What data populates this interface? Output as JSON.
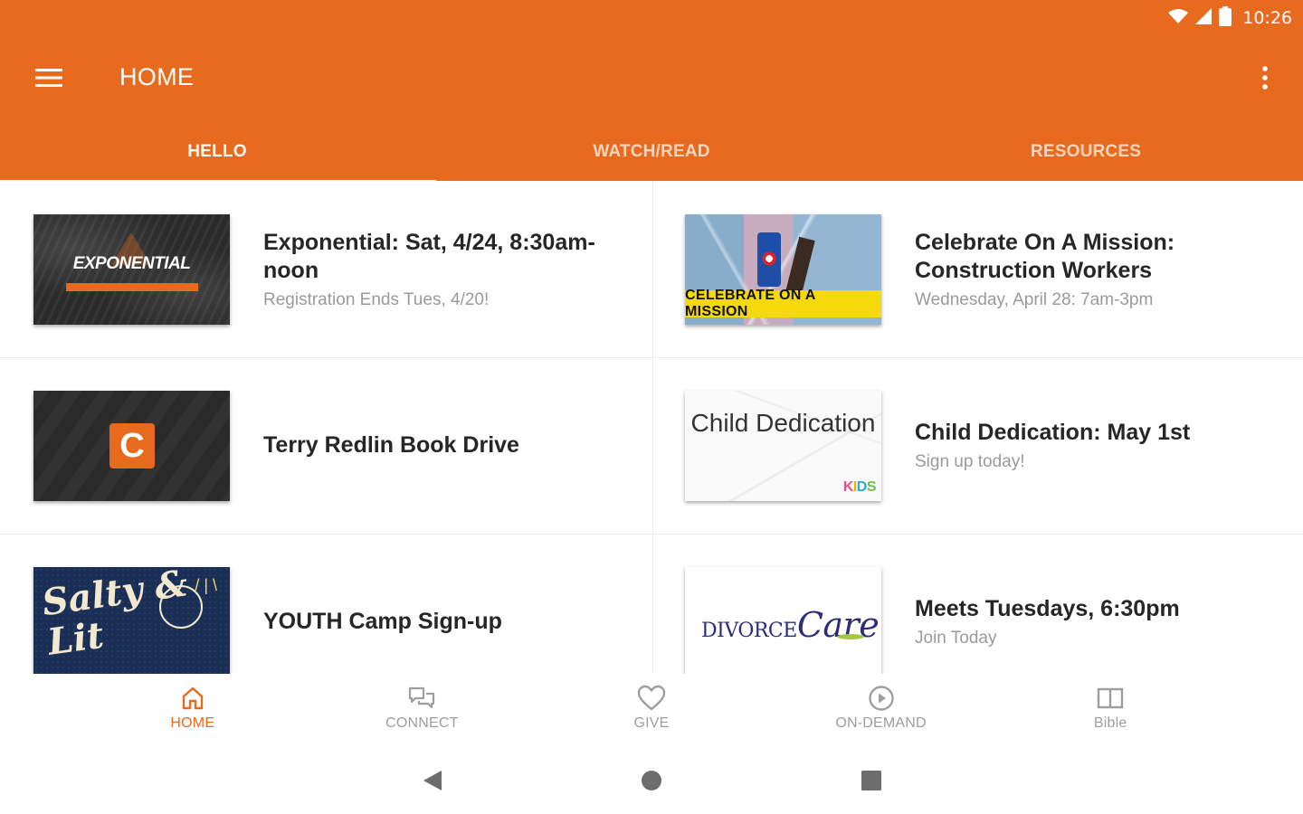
{
  "status_bar": {
    "time": "10:26"
  },
  "app_bar": {
    "title": "HOME"
  },
  "tabs": [
    {
      "label": "HELLO",
      "active": true
    },
    {
      "label": "WATCH/READ",
      "active": false
    },
    {
      "label": "RESOURCES",
      "active": false
    }
  ],
  "feed": [
    {
      "title": "Exponential: Sat, 4/24, 8:30am-noon",
      "subtitle": "Registration Ends Tues, 4/20!",
      "image_text": "EXPONENTIAL"
    },
    {
      "title": "Celebrate On A Mission: Construction Workers",
      "subtitle": "Wednesday, April 28: 7am-3pm",
      "image_text": "CELEBRATE ON A MISSION"
    },
    {
      "title": "Terry Redlin Book Drive",
      "subtitle": "",
      "image_text": "C"
    },
    {
      "title": "Child Dedication: May 1st",
      "subtitle": "Sign up today!",
      "image_text": "Child Dedication",
      "image_badge": "KIDS"
    },
    {
      "title": "YOUTH Camp Sign-up",
      "subtitle": "",
      "image_text": "Salty & Lit"
    },
    {
      "title": "Meets Tuesdays, 6:30pm",
      "subtitle": "Join Today",
      "image_text": "DIVORCE",
      "image_text_2": "Care"
    }
  ],
  "bottom_nav": [
    {
      "label": "HOME",
      "icon": "home-icon",
      "active": true
    },
    {
      "label": "CONNECT",
      "icon": "chat-icon",
      "active": false
    },
    {
      "label": "GIVE",
      "icon": "heart-icon",
      "active": false
    },
    {
      "label": "ON-DEMAND",
      "icon": "play-icon",
      "active": false
    },
    {
      "label": "Bible",
      "icon": "book-icon",
      "active": false
    }
  ],
  "colors": {
    "accent": "#E86A1E",
    "inactive": "#9e9e9e",
    "title_text": "#262626",
    "subtitle_text": "#9a9a9a"
  }
}
